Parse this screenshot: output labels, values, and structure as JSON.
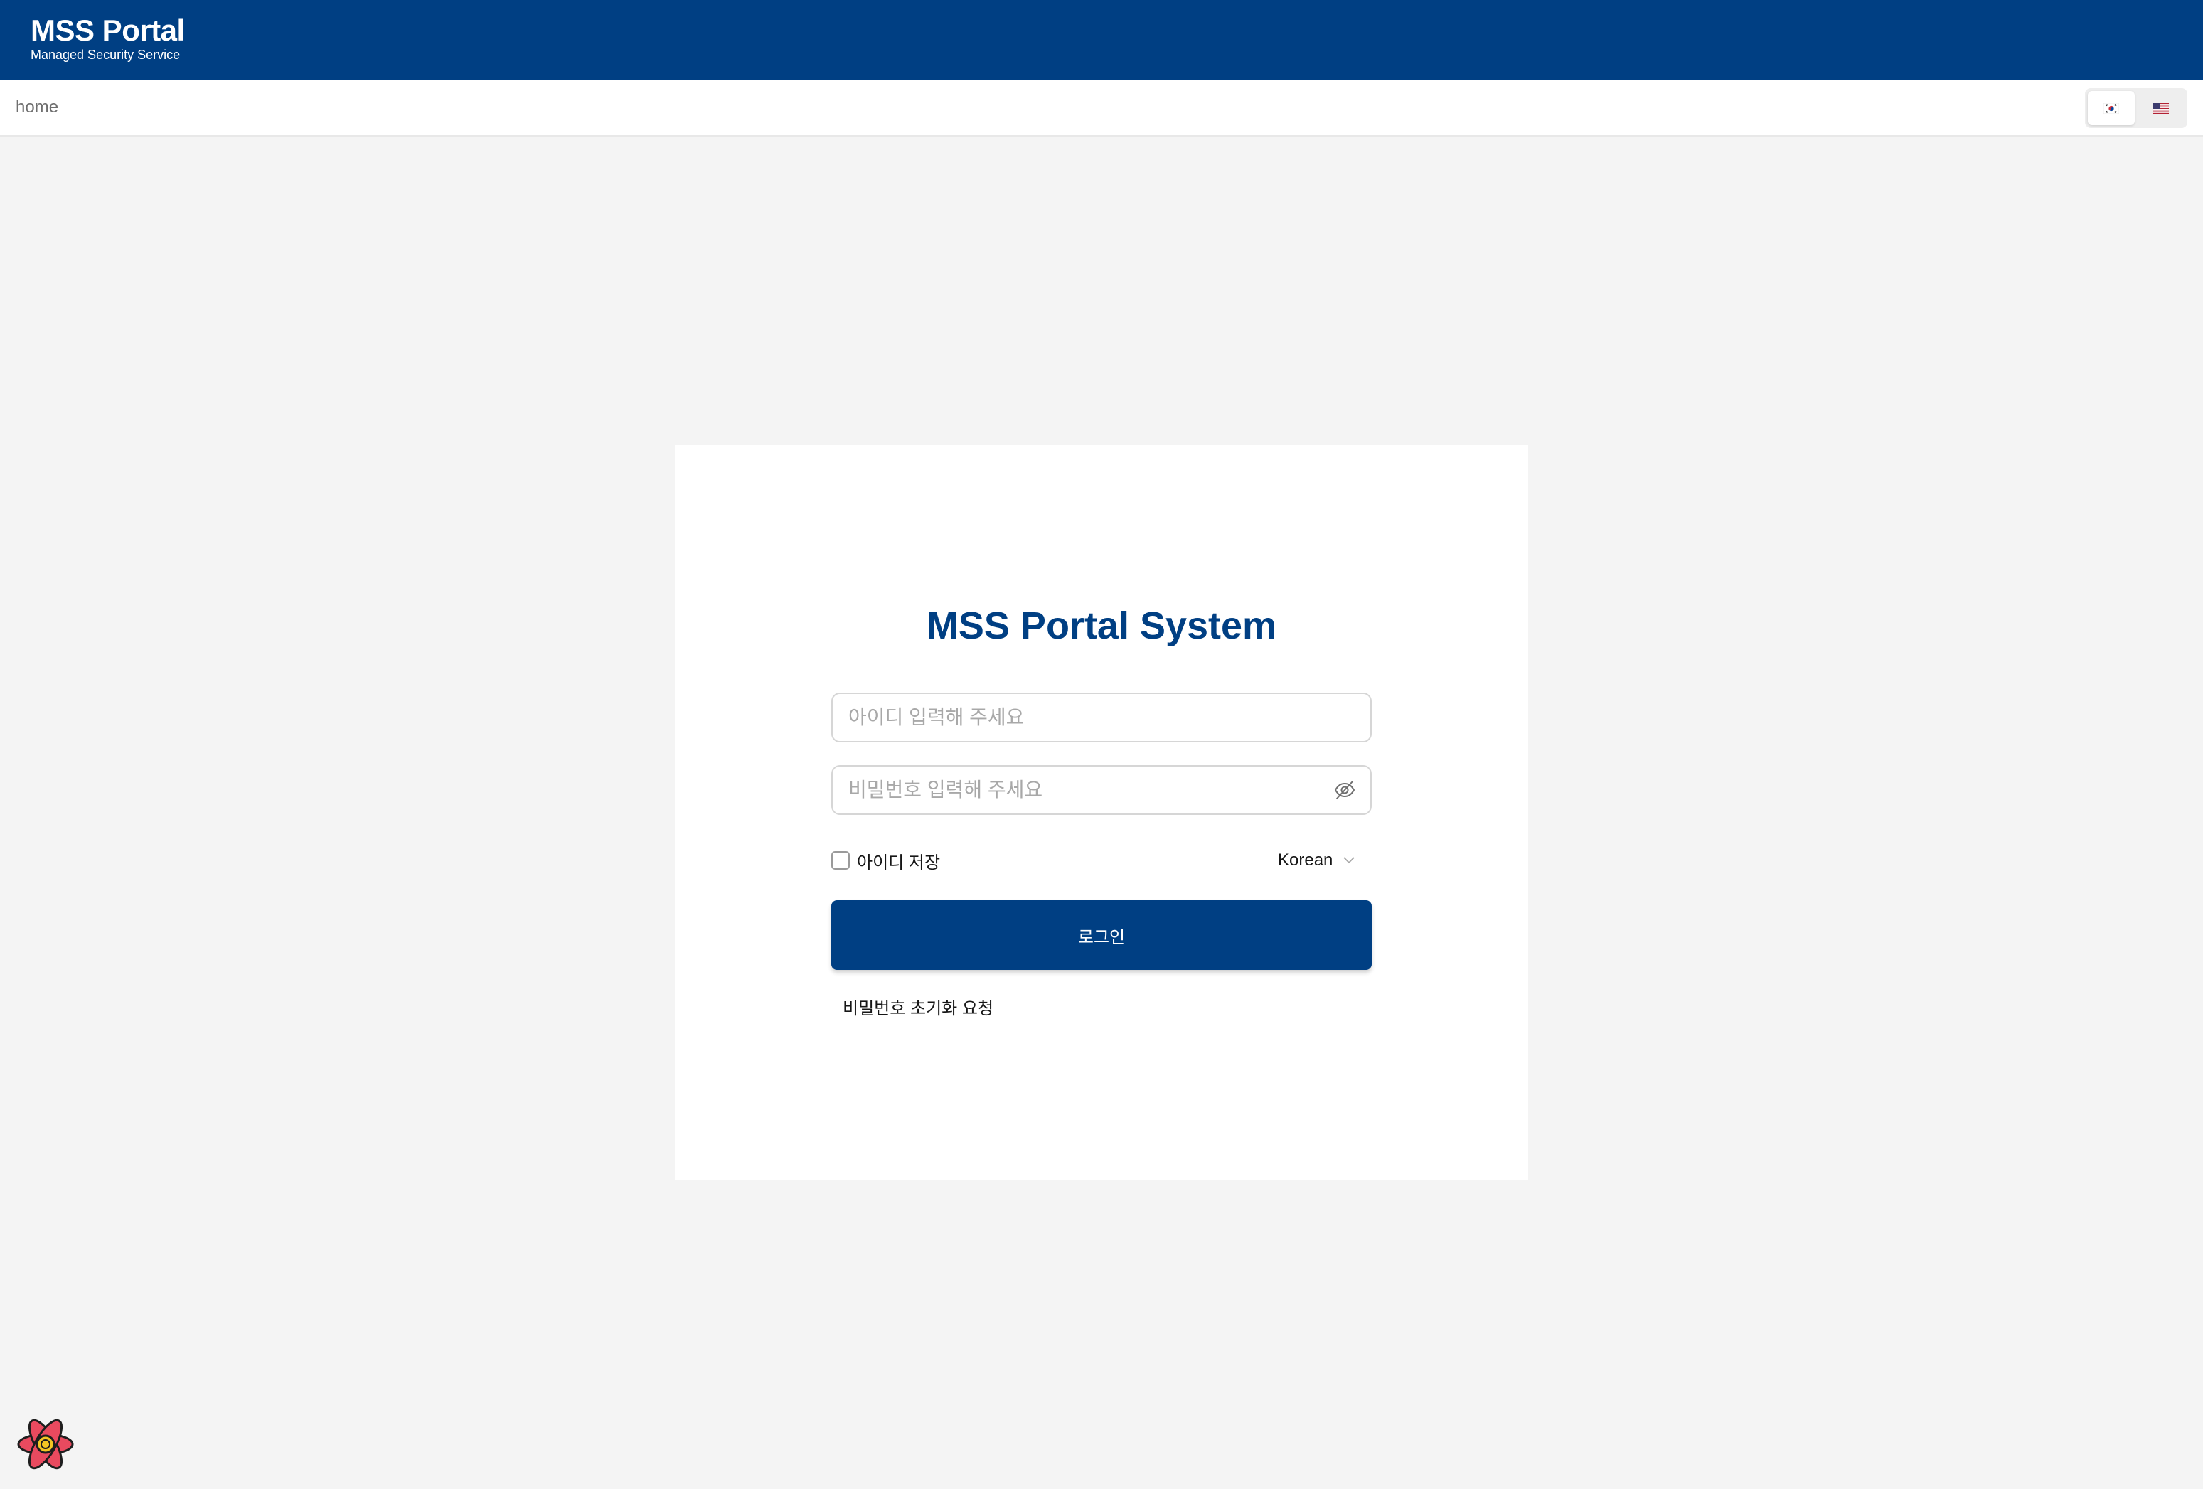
{
  "header": {
    "brand_title": "MSS Portal",
    "brand_subtitle": "Managed Security Service",
    "background_color": "#003f83"
  },
  "navbar": {
    "breadcrumb": "home",
    "language_toggle": [
      {
        "code": "ko",
        "icon": "korea-flag-icon",
        "active": true
      },
      {
        "code": "en",
        "icon": "us-flag-icon",
        "active": false
      }
    ]
  },
  "login": {
    "title": "MSS Portal System",
    "id_placeholder": "아이디 입력해 주세요",
    "id_value": "",
    "password_placeholder": "비밀번호 입력해 주세요",
    "password_value": "",
    "password_toggle_icon": "eye-off-icon",
    "remember_id_label": "아이디 저장",
    "remember_id_checked": false,
    "language_select_value": "Korean",
    "submit_label": "로그인",
    "reset_password_link": "비밀번호 초기화 요청",
    "accent_color": "#003f83"
  },
  "footer": {
    "badge_icon": "react-logo-icon"
  }
}
